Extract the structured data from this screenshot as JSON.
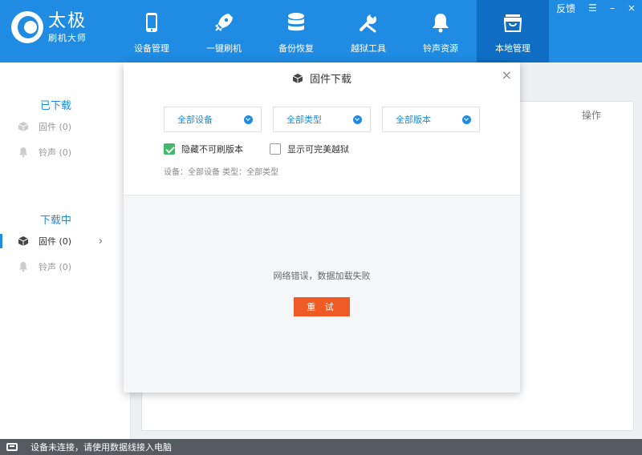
{
  "header": {
    "logo_title": "太极",
    "logo_sub": "刷机大师",
    "nav": [
      {
        "label": "设备管理",
        "icon": "phone-icon"
      },
      {
        "label": "一键刷机",
        "icon": "rocket-icon"
      },
      {
        "label": "备份恢复",
        "icon": "database-icon"
      },
      {
        "label": "越狱工具",
        "icon": "wrench-icon"
      },
      {
        "label": "铃声资源",
        "icon": "bell-icon"
      },
      {
        "label": "本地管理",
        "icon": "bag-icon",
        "active": true
      }
    ],
    "window_controls": {
      "feedback": "反馈",
      "menu": "☰",
      "minimize": "–",
      "close": "×"
    }
  },
  "sidebar": {
    "downloaded_title": "已下载",
    "downloaded_items": [
      {
        "label": "固件 (0)",
        "icon": "box-icon"
      },
      {
        "label": "铃声 (0)",
        "icon": "bell-icon"
      }
    ],
    "downloading_title": "下载中",
    "downloading_items": [
      {
        "label": "固件 (0)",
        "icon": "box-icon",
        "active": true
      },
      {
        "label": "铃声 (0)",
        "icon": "bell-icon"
      }
    ]
  },
  "main": {
    "column_action": "操作"
  },
  "modal": {
    "title": "固件下载",
    "close": "×",
    "filters": {
      "device": "全部设备",
      "type": "全部类型",
      "version": "全部版本"
    },
    "checkboxes": {
      "hide_unflashable": {
        "label": "隐藏不可刷版本",
        "checked": true
      },
      "show_perfect_jailbreak": {
        "label": "显示可完美越狱",
        "checked": false
      }
    },
    "filter_info": "设备：全部设备 类型：全部类型",
    "error_message": "网络错误，数据加载失败",
    "retry_label": "重 试"
  },
  "statusbar": {
    "text": "设备未连接，请使用数据线接入电脑"
  },
  "colors": {
    "primary": "#1f8be2",
    "nav_active": "#0f6ec4",
    "retry": "#f05a24",
    "check_on": "#41b86a",
    "statusbar": "#555a60"
  }
}
